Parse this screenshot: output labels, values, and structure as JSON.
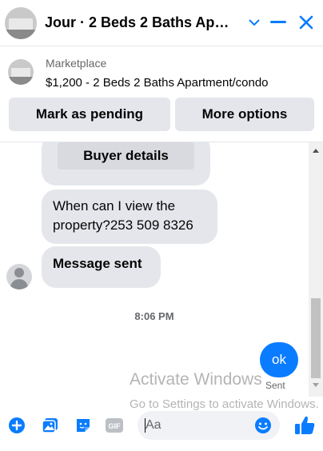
{
  "header": {
    "title": "Jour · 2 Beds 2 Baths Apar...",
    "icons": [
      "chevron-down-icon",
      "minimize-icon",
      "close-icon"
    ],
    "accent": "#0a7cff"
  },
  "listing": {
    "label": "Marketplace",
    "description": "$1,200 - 2 Beds 2 Baths Apartment/condo"
  },
  "actions": {
    "mark_pending": "Mark as pending",
    "more_options": "More options"
  },
  "messages": {
    "buyer_details": "Buyer details",
    "question": "When can I view the property?253 509 8326",
    "status": "Message sent",
    "timestamp": "8:06 PM",
    "outgoing": "ok",
    "delivery": "Sent"
  },
  "watermark": {
    "line1": "Activate Windows",
    "line2": "Go to Settings to activate Windows."
  },
  "composer": {
    "placeholder": "Aa",
    "icons": [
      "plus-icon",
      "photo-icon",
      "sticker-icon",
      "gif-icon",
      "emoji-icon",
      "like-icon"
    ]
  }
}
